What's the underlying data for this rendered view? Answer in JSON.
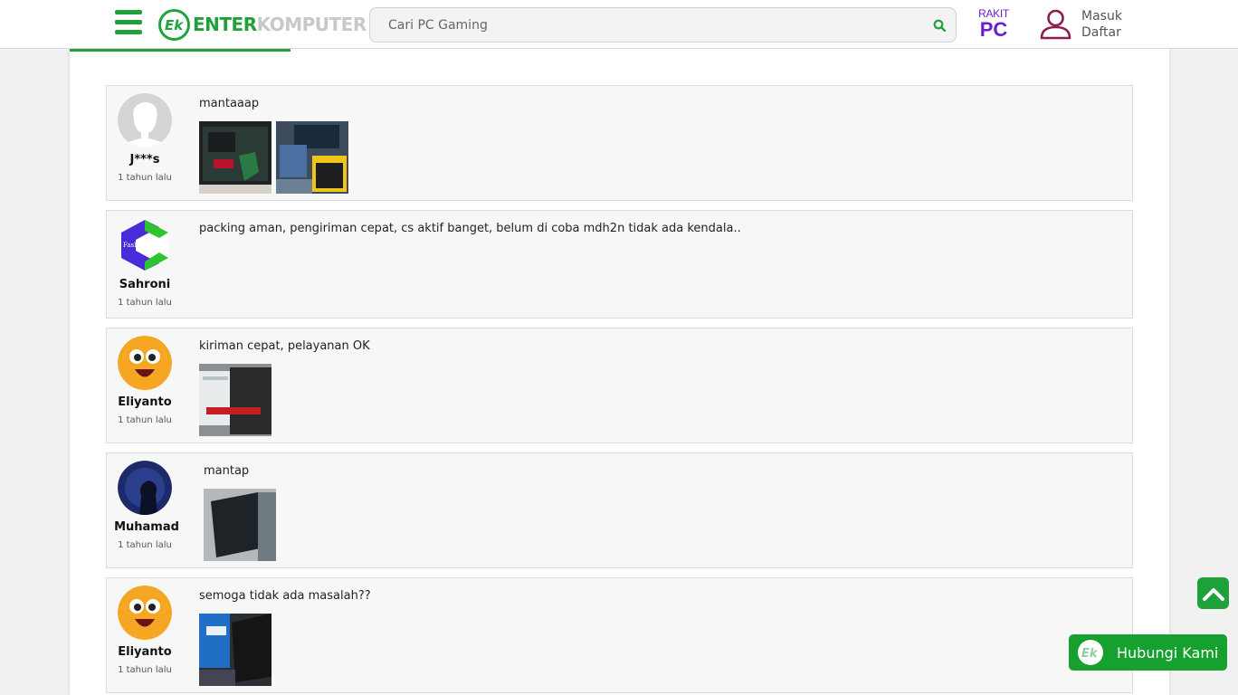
{
  "header": {
    "logo_left": "ENTER",
    "logo_right": "KOMPUTER",
    "search_placeholder": "Cari PC Gaming",
    "rakit_top": "RAKIT",
    "rakit_pc": "PC",
    "login": "Masuk",
    "register": "Daftar"
  },
  "reviews": [
    {
      "name": "J***s",
      "time": "1 tahun lalu",
      "comment": "mantaaap"
    },
    {
      "name": "Sahroni",
      "time": "1 tahun lalu",
      "comment": "packing aman, pengiriman cepat, cs aktif banget, belum di coba mdh2n tidak ada kendala.."
    },
    {
      "name": "Eliyanto",
      "time": "1 tahun lalu",
      "comment": "kiriman cepat, pelayanan OK"
    },
    {
      "name": "Muhamad",
      "time": "1 tahun lalu",
      "comment": "mantap"
    },
    {
      "name": "Eliyanto",
      "time": "1 tahun lalu",
      "comment": "semoga tidak ada masalah??"
    }
  ],
  "contact_label": "Hubungi Kami",
  "colors": {
    "brand_green": "#1fa13a",
    "rakit_purple": "#6a1fd1",
    "user_icon": "#8b1d52"
  }
}
